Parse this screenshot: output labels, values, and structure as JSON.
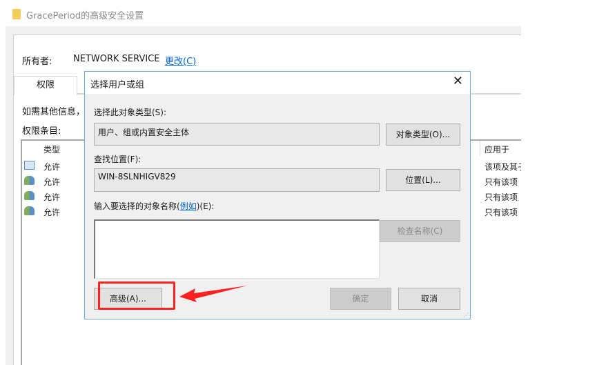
{
  "window": {
    "title": "GracePeriod的高级安全设置",
    "owner_label": "所有者:",
    "owner_value": "NETWORK SERVICE",
    "change_link": "更改(C)",
    "tab": "权限",
    "info_text": "如需其他信息，",
    "entries_label": "权限条目:",
    "columns": {
      "type": "类型",
      "applies": "应用于"
    },
    "rows": [
      {
        "type": "允许",
        "applies": "该项及其子",
        "icon": "computer-icon"
      },
      {
        "type": "允许",
        "applies": "只有该项",
        "icon": "users-icon"
      },
      {
        "type": "允许",
        "applies": "只有该项",
        "icon": "users-icon"
      },
      {
        "type": "允许",
        "applies": "只有该项",
        "icon": "users-icon"
      }
    ]
  },
  "dialog": {
    "title": "选择用户或组",
    "object_type_label": "选择此对象类型(S):",
    "object_type_value": "用户、组或内置安全主体",
    "object_type_button": "对象类型(O)...",
    "location_label": "查找位置(F):",
    "location_value": "WIN-8SLNHIGV829",
    "location_button": "位置(L)...",
    "names_label_pre": "输入要选择的对象名称(",
    "names_label_link": "例如",
    "names_label_post": ")(E):",
    "names_value": "",
    "check_button": "检查名称(C)",
    "advanced_button": "高级(A)...",
    "ok_button": "确定",
    "cancel_button": "取消"
  },
  "annotation": {
    "color": "#ff2020"
  }
}
